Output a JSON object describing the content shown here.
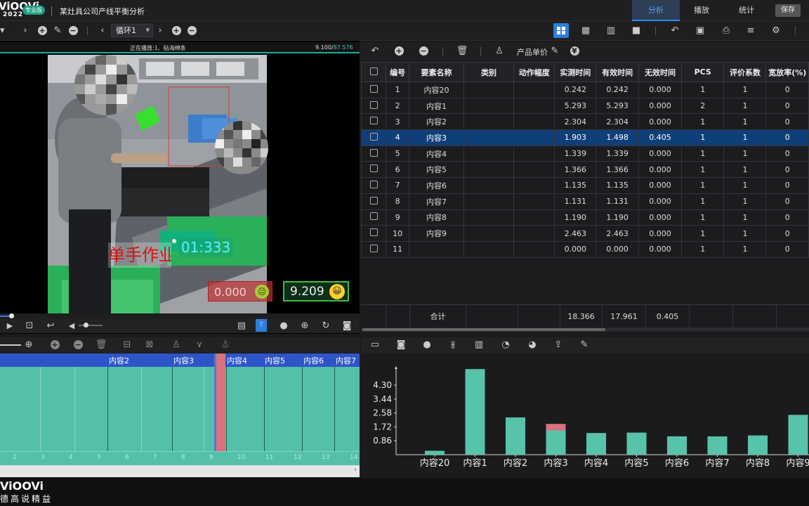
{
  "app": {
    "logo": "ViOOVi",
    "year": "2022",
    "edition": "专业版",
    "title": "某灶具公司产线平衡分析"
  },
  "tabs": {
    "analyze": "分析",
    "play": "播放",
    "stats": "统计",
    "save": "保存"
  },
  "toolbar": {
    "loop_select": "循环1"
  },
  "video": {
    "playing_text": "正在播放:1、贴海绵条",
    "frame_current": "9.100/",
    "frame_total": "87.576",
    "overlay_text": "单手作业",
    "timer": "01:333",
    "score_bad": "0.000",
    "score_good": "9.209"
  },
  "grid_toolbar": {
    "unit_price": "产品单价",
    "currency": "¥"
  },
  "table": {
    "headers": [
      "",
      "编号",
      "要素名称",
      "类别",
      "动作幅度",
      "实测时间",
      "有效时间",
      "无效时间",
      "PCS",
      "评价系数",
      "宽放率(%)"
    ],
    "rows": [
      [
        "1",
        "内容20",
        "",
        "",
        "0.242",
        "0.242",
        "0.000",
        "1",
        "1",
        "0"
      ],
      [
        "2",
        "内容1",
        "",
        "",
        "5.293",
        "5.293",
        "0.000",
        "2",
        "1",
        "0"
      ],
      [
        "3",
        "内容2",
        "",
        "",
        "2.304",
        "2.304",
        "0.000",
        "1",
        "1",
        "0"
      ],
      [
        "4",
        "内容3",
        "",
        "",
        "1.903",
        "1.498",
        "0.405",
        "1",
        "1",
        "0"
      ],
      [
        "5",
        "内容4",
        "",
        "",
        "1.339",
        "1.339",
        "0.000",
        "1",
        "1",
        "0"
      ],
      [
        "6",
        "内容5",
        "",
        "",
        "1.366",
        "1.366",
        "0.000",
        "1",
        "1",
        "0"
      ],
      [
        "7",
        "内容6",
        "",
        "",
        "1.135",
        "1.135",
        "0.000",
        "1",
        "1",
        "0"
      ],
      [
        "8",
        "内容7",
        "",
        "",
        "1.131",
        "1.131",
        "0.000",
        "1",
        "1",
        "0"
      ],
      [
        "9",
        "内容8",
        "",
        "",
        "1.190",
        "1.190",
        "0.000",
        "1",
        "1",
        "0"
      ],
      [
        "10",
        "内容9",
        "",
        "",
        "2.463",
        "2.463",
        "0.000",
        "1",
        "1",
        "0"
      ],
      [
        "11",
        "",
        "",
        "",
        "0.000",
        "0.000",
        "0.000",
        "1",
        "1",
        "0"
      ]
    ],
    "selected_row": 3,
    "total": {
      "label": "合计",
      "measured": "18.366",
      "effective": "17.961",
      "ineffective": "0.405"
    }
  },
  "timeline": {
    "segments": [
      "内容2",
      "内容3",
      "内容4",
      "内容5",
      "内容6",
      "内容7"
    ],
    "ruler": [
      "2",
      "3",
      "4",
      "5",
      "6",
      "7",
      "8",
      "9",
      "10",
      "11",
      "12",
      "13",
      "14"
    ]
  },
  "chart_data": {
    "type": "bar",
    "categories": [
      "内容20",
      "内容1",
      "内容2",
      "内容3",
      "内容4",
      "内容5",
      "内容6",
      "内容7",
      "内容8",
      "内容9"
    ],
    "series": [
      {
        "values": [
          0.242,
          5.293,
          2.304,
          1.498,
          1.339,
          1.366,
          1.135,
          1.131,
          1.19,
          2.463
        ],
        "color": "#58c3ab"
      },
      {
        "values": [
          0,
          0,
          0,
          0.405,
          0,
          0,
          0,
          0,
          0,
          0
        ],
        "color": "#d9727c"
      }
    ],
    "yticks": [
      "4.30",
      "3.44",
      "2.58",
      "1.72",
      "0.86"
    ],
    "ylim": [
      0,
      5.3
    ],
    "stacked": true
  },
  "watermark": {
    "brand": "ViOOVi",
    "slogan": "德高说精益"
  }
}
